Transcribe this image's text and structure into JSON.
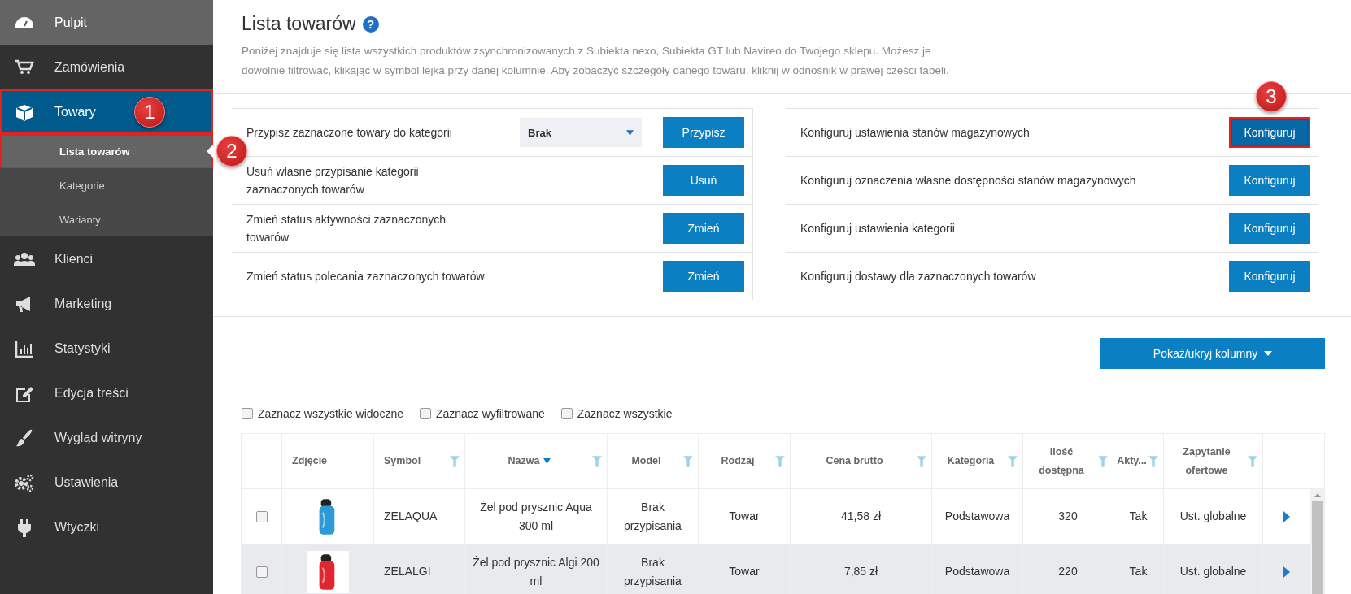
{
  "sidebar": {
    "items": [
      {
        "label": "Pulpit",
        "hover": true,
        "selected": false,
        "highlighted": false
      },
      {
        "label": "Zamówienia",
        "hover": false,
        "selected": false,
        "highlighted": false
      },
      {
        "label": "Towary",
        "hover": false,
        "selected": true,
        "highlighted": true,
        "callout": "1",
        "children": [
          {
            "label": "Lista towarów",
            "selected": true,
            "highlighted": true,
            "callout": "2"
          },
          {
            "label": "Kategorie",
            "selected": false,
            "highlighted": false
          },
          {
            "label": "Warianty",
            "selected": false,
            "highlighted": false
          }
        ]
      },
      {
        "label": "Klienci",
        "hover": false,
        "selected": false,
        "highlighted": false
      },
      {
        "label": "Marketing",
        "hover": false,
        "selected": false,
        "highlighted": false
      },
      {
        "label": "Statystyki",
        "hover": false,
        "selected": false,
        "highlighted": false
      },
      {
        "label": "Edycja treści",
        "hover": false,
        "selected": false,
        "highlighted": false
      },
      {
        "label": "Wygląd witryny",
        "hover": false,
        "selected": false,
        "highlighted": false
      },
      {
        "label": "Ustawienia",
        "hover": false,
        "selected": false,
        "highlighted": false
      },
      {
        "label": "Wtyczki",
        "hover": false,
        "selected": false,
        "highlighted": false
      }
    ]
  },
  "header": {
    "title": "Lista towarów",
    "help": "?",
    "description": "Poniżej znajduje się lista wszystkich produktów zsynchronizowanych z Subiekta nexo, Subiekta GT lub Navireo do Twojego sklepu. Możesz je dowolnie filtrować, klikając w symbol lejka przy danej kolumnie. Aby zobaczyć szczegóły danego towaru, kliknij w odnośnik w prawej części tabeli."
  },
  "bulk_actions": [
    {
      "text": "Przypisz zaznaczone towary do kategorii",
      "dropdown": "Brak",
      "button": "Przypisz"
    },
    {
      "text": "Usuń własne przypisanie kategorii zaznaczonych towarów",
      "button": "Usuń"
    },
    {
      "text": "Zmień status aktywności zaznaczonych towarów",
      "button": "Zmień"
    },
    {
      "text": "Zmień status polecania zaznaczonych towarów",
      "button": "Zmień"
    }
  ],
  "config_actions": [
    {
      "text": "Konfiguruj ustawienia stanów magazynowych",
      "button": "Konfiguruj",
      "highlighted": true,
      "callout": "3"
    },
    {
      "text": "Konfiguruj oznaczenia własne dostępności stanów magazynowych",
      "button": "Konfiguruj",
      "highlighted": false
    },
    {
      "text": "Konfiguruj ustawienia kategorii",
      "button": "Konfiguruj",
      "highlighted": false
    },
    {
      "text": "Konfiguruj dostawy dla zaznaczonych towarów",
      "button": "Konfiguruj",
      "highlighted": false
    }
  ],
  "columns_button": "Pokaż/ukryj kolumny",
  "select_options": [
    {
      "label": "Zaznacz wszystkie widoczne",
      "checked": false
    },
    {
      "label": "Zaznacz wyfiltrowane",
      "checked": false
    },
    {
      "label": "Zaznacz wszystkie",
      "checked": false
    }
  ],
  "table": {
    "columns": [
      {
        "label": "Zdjęcie",
        "filter": false,
        "sorted": false
      },
      {
        "label": "Symbol",
        "filter": true,
        "sorted": false
      },
      {
        "label": "Nazwa",
        "filter": true,
        "sorted": true
      },
      {
        "label": "Model",
        "filter": true,
        "sorted": false
      },
      {
        "label": "Rodzaj",
        "filter": true,
        "sorted": false
      },
      {
        "label": "Cena brutto",
        "filter": true,
        "sorted": false
      },
      {
        "label": "Kategoria",
        "filter": true,
        "sorted": false
      },
      {
        "label": "Ilość dostępna",
        "filter": true,
        "sorted": false
      },
      {
        "label": "Akty...",
        "filter": true,
        "sorted": false
      },
      {
        "label": "Zapytanie ofertowe",
        "filter": true,
        "sorted": false
      }
    ],
    "rows": [
      {
        "checked": false,
        "selected": false,
        "symbol": "ZELAQUA",
        "name": "Żel pod prysznic Aqua 300 ml",
        "model": "Brak przypisania",
        "type": "Towar",
        "price": "41,58 zł",
        "category": "Podstawowa",
        "quantity": "320",
        "active": "Tak",
        "quote": "Ust. globalne"
      },
      {
        "checked": false,
        "selected": true,
        "symbol": "ZELALGI",
        "name": "Żel pod prysznic Algi 200 ml",
        "model": "Brak przypisania",
        "type": "Towar",
        "price": "7,85 zł",
        "category": "Podstawowa",
        "quantity": "220",
        "active": "Tak",
        "quote": "Ust. globalne"
      }
    ]
  }
}
